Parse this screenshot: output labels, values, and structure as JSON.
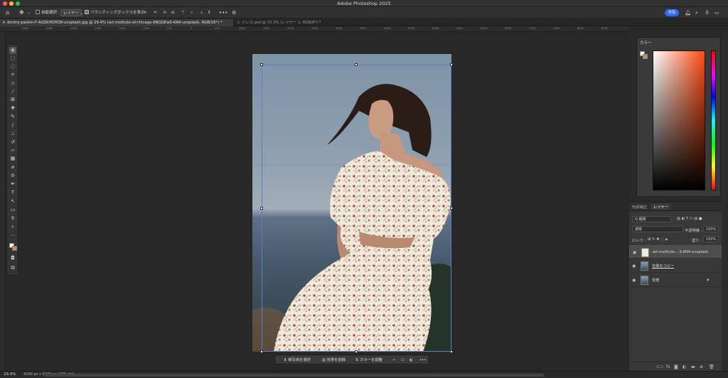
{
  "app": {
    "title": "Adobe Photoshop 2025"
  },
  "colors": {
    "accent": "#2d6bf0",
    "panel": "#383838",
    "canvas_bg": "#282828"
  },
  "options_bar": {
    "home_icon": "home-icon",
    "move_icon": "move-tool-icon",
    "auto_select_label": "自動選択 :",
    "auto_select_value": "レイヤー",
    "bbox_label": "バウンディングボックスを表示",
    "share_label": "共有",
    "more_label": "•••"
  },
  "tabs": [
    {
      "label": "dmitry-pankin-F-AUZKHOHO8-unsplash.jpg @ 29.4% (art-institute-of-chicago-6NQGEwS-KN4-unsplash, RGB/16*) *",
      "active": true
    },
    {
      "label": "ドレス.psd @ 33.3% (レイヤー 1, RGB/8*) *",
      "active": false
    }
  ],
  "ruler": {
    "numbers": [
      "-3500",
      "-3000",
      "-2500",
      "-2000",
      "-1500",
      "-1000",
      "-500",
      "0",
      "500",
      "1000",
      "1500",
      "2000",
      "2500",
      "3000",
      "3500",
      "4000",
      "4500",
      "5000",
      "5500",
      "6000",
      "6500",
      "7000",
      "7500",
      "8000",
      "8500"
    ]
  },
  "context_bar": {
    "select_subject": "被写体を選択",
    "remove_bg": "背景を削除",
    "adjust_color": "カラーを調整",
    "more": "•••"
  },
  "status": {
    "zoom": "29.4%",
    "doc_info": "4160 px x 6240 px (300 ppi)"
  },
  "color_panel": {
    "title": "カラー",
    "foreground": "#ffffff",
    "background": "#c98863"
  },
  "layers_panel": {
    "tabs": [
      {
        "label": "色調補正",
        "active": false
      },
      {
        "label": "レイヤー",
        "active": true
      }
    ],
    "filter_label": "Q 種類",
    "blend_mode": "通常",
    "opacity_label": "不透明度 :",
    "opacity_value": "100%",
    "lock_label": "ロック :",
    "fill_label": "塗り :",
    "fill_value": "100%",
    "layers": [
      {
        "name": "art-institute-...S-KN4-unsplash",
        "selected": true
      },
      {
        "name": "背景のコピー",
        "selected": false
      },
      {
        "name": "背景",
        "selected": false
      }
    ]
  }
}
